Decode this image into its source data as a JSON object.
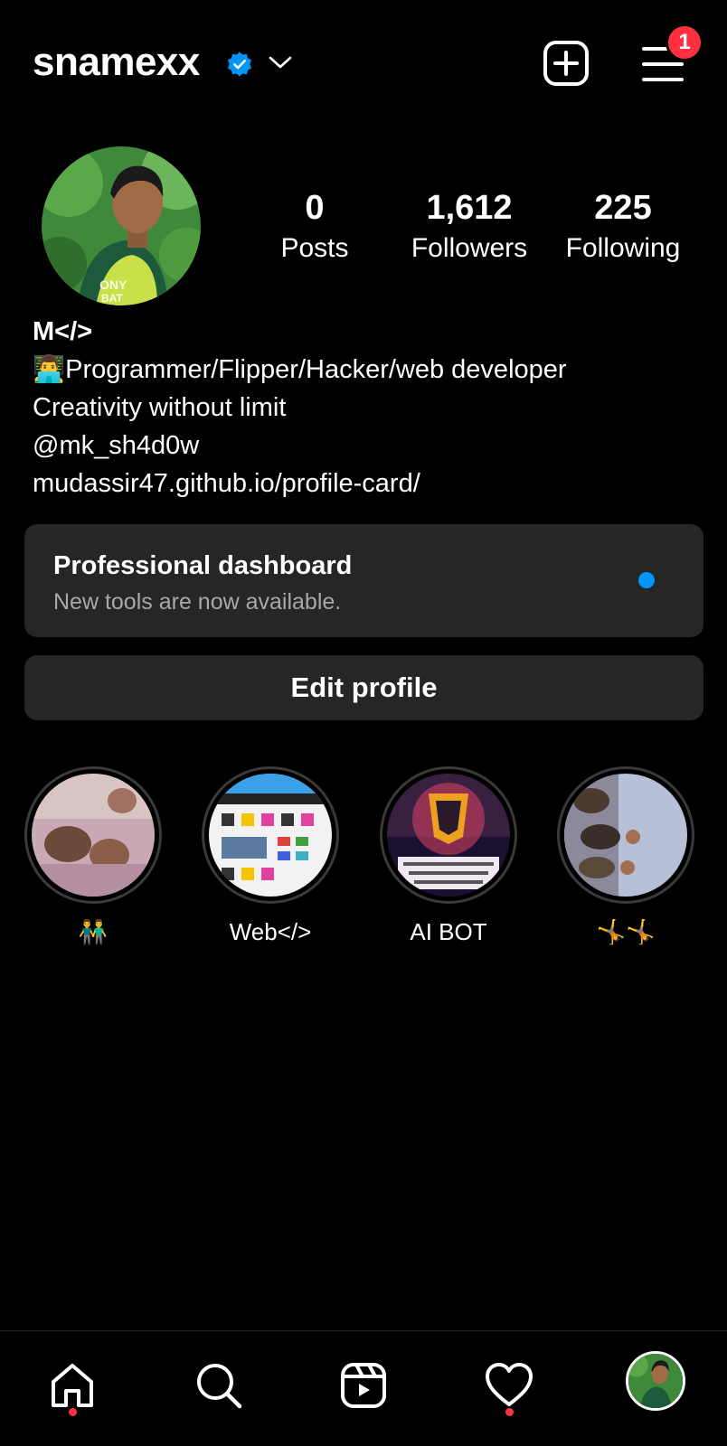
{
  "header": {
    "username": "snamexx",
    "notification_count": "1"
  },
  "stats": [
    {
      "value": "0",
      "label": "Posts"
    },
    {
      "value": "1,612",
      "label": "Followers"
    },
    {
      "value": "225",
      "label": "Following"
    }
  ],
  "bio": {
    "name": "M</>",
    "line1": "👨‍💻Programmer/Flipper/Hacker/web developer",
    "line2": "Creativity without limit",
    "handle": "@mk_sh4d0w",
    "link": "mudassir47.github.io/profile-card/"
  },
  "dashboard": {
    "title": "Professional dashboard",
    "subtitle": "New tools are now available."
  },
  "edit_profile_label": "Edit profile",
  "highlights": [
    {
      "label": "👬"
    },
    {
      "label": "Web</>"
    },
    {
      "label": "AI BOT"
    },
    {
      "label": "🤸🤸"
    }
  ],
  "colors": {
    "background": "#000000",
    "card": "#262626",
    "verified": "#0095f6",
    "badge": "#ff3040",
    "muted": "#a8a8a8"
  },
  "icons": [
    "verified-badge-icon",
    "chevron-down-icon",
    "new-post-icon",
    "menu-icon",
    "home-icon",
    "search-icon",
    "reels-icon",
    "heart-icon"
  ]
}
